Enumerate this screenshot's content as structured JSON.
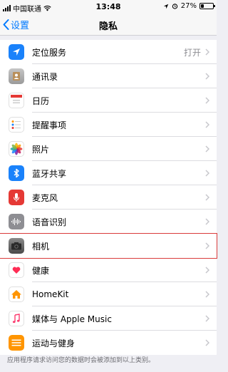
{
  "status_bar": {
    "carrier": "中国联通",
    "time": "13:48",
    "battery": "27%",
    "battery_level": 0.27
  },
  "nav": {
    "back_label": "设置",
    "title": "隐私"
  },
  "rows": [
    {
      "label": "定位服务",
      "value": "打开",
      "icon": "location-arrow-icon",
      "color": "#1a82fb"
    },
    {
      "label": "通讯录",
      "value": "",
      "icon": "contacts-icon",
      "color": "#a8a8a8"
    },
    {
      "label": "日历",
      "value": "",
      "icon": "calendar-icon",
      "color": "#ffffff"
    },
    {
      "label": "提醒事项",
      "value": "",
      "icon": "reminders-icon",
      "color": "#ffffff"
    },
    {
      "label": "照片",
      "value": "",
      "icon": "photos-icon",
      "color": "#ffffff"
    },
    {
      "label": "蓝牙共享",
      "value": "",
      "icon": "bluetooth-icon",
      "color": "#1a82fb"
    },
    {
      "label": "麦克风",
      "value": "",
      "icon": "microphone-icon",
      "color": "#e53935"
    },
    {
      "label": "语音识别",
      "value": "",
      "icon": "waveform-icon",
      "color": "#8e8e93"
    },
    {
      "label": "相机",
      "value": "",
      "icon": "camera-icon",
      "color": "#6b6b6b"
    },
    {
      "label": "健康",
      "value": "",
      "icon": "heart-icon",
      "color": "#ffffff"
    },
    {
      "label": "HomeKit",
      "value": "",
      "icon": "home-icon",
      "color": "#ff9500"
    },
    {
      "label": "媒体与 Apple Music",
      "value": "",
      "icon": "music-note-icon",
      "color": "#ffffff"
    },
    {
      "label": "运动与健身",
      "value": "",
      "icon": "fitness-icon",
      "color": "#ff9500"
    }
  ],
  "footer_text": "应用程序请求访问您的数据时会被添加到以上类别。"
}
